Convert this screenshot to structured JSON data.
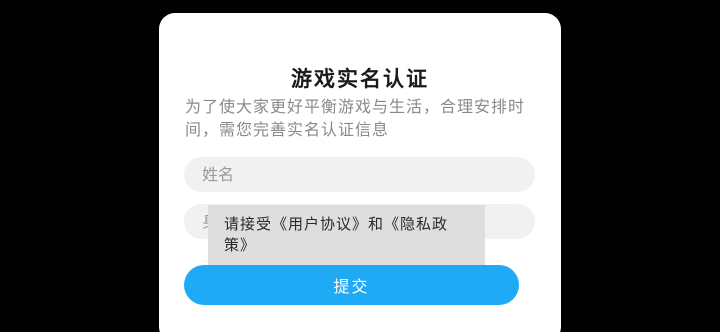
{
  "dialog": {
    "title": "游戏实名认证",
    "description": "为了使大家更好平衡游戏与生活，合理安排时间，需您完善实名认证信息",
    "name_field": {
      "value": "",
      "placeholder": "姓名"
    },
    "id_field": {
      "value": "",
      "placeholder": "身份证号"
    },
    "submit_label": "提交"
  },
  "toast": {
    "message": "请接受《用户协议》和《隐私政策》"
  },
  "colors": {
    "accent": "#1faaf5",
    "dialog_bg": "#ffffff",
    "backdrop": "#000000",
    "toast_bg": "#dedede"
  }
}
